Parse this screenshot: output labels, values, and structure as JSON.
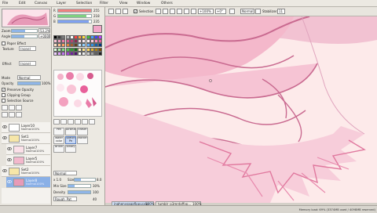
{
  "menu": {
    "file": "File",
    "edit": "Edit",
    "canvas": "Canvas",
    "layer": "Layer",
    "selection": "Selection",
    "filter": "Filter",
    "view": "View",
    "window": "Window",
    "others": "Others"
  },
  "toolbar": {
    "selection_label": "Selection",
    "zoom_value": "+100%",
    "angle_value": "+0°",
    "mode_value": "Normal",
    "stabilizer_label": "Stabilizer",
    "stabilizer_value": "11"
  },
  "navigator": {
    "zoom_label": "Zoom",
    "zoom_value": "53.2%",
    "angle_label": "Angle",
    "angle_value": "+0000"
  },
  "paper": {
    "effect_label": "Paper Effect",
    "texture_label": "Texture",
    "texture_value": "(none)",
    "effect_label_2": "Effect",
    "effect_value": "(none)"
  },
  "layer_props": {
    "mode_label": "Mode",
    "mode_value": "Normal",
    "opacity_label": "Opacity",
    "opacity_value": "100%",
    "preserve_opacity": "Preserve Opacity",
    "clipping_group": "Clipping Group",
    "selection_source": "Selection Source"
  },
  "layers": [
    {
      "name": "Layer10",
      "mode": "Normal",
      "op": "100%"
    },
    {
      "name": "Set1",
      "mode": "Normal",
      "op": "100%"
    },
    {
      "name": "Layer7",
      "mode": "Normal",
      "op": "100%"
    },
    {
      "name": "Layer5",
      "mode": "Normal",
      "op": "100%"
    },
    {
      "name": "Set2",
      "mode": "Normal",
      "op": "100%"
    },
    {
      "name": "Layer8",
      "mode": "Normal",
      "op": "100%"
    }
  ],
  "color": {
    "r_value": "255",
    "g_value": "218",
    "b_value": "235",
    "fg_color": "#f2a6c8",
    "palette": [
      "#000000",
      "#3a3a3a",
      "#7a7a7a",
      "#b8b8b8",
      "#ffffff",
      "#ff4040",
      "#ffa040",
      "#ffe040",
      "#40c040",
      "#40a0ff",
      "#4040ff",
      "#c040ff",
      "#f9c4d6",
      "#f3a1bf",
      "#e97ca8",
      "#d65b8e",
      "#b8416f",
      "#8a2a52",
      "#fbd9e5",
      "#fce8ef",
      "#fff0f5",
      "#ffd0e0",
      "#ff90b8",
      "#e8609a",
      "#ffe0c8",
      "#ffc090",
      "#ffa060",
      "#e08040",
      "#a06030",
      "#604020",
      "#c0e8ff",
      "#90d0ff",
      "#60b0ff",
      "#3090e0",
      "#1060b0",
      "#003880",
      "#e0ffe0",
      "#b0f0b0",
      "#80e080",
      "#50c050",
      "#30a030",
      "#107010",
      "#fff4c0",
      "#ffe890",
      "#ffd860",
      "#e0b030",
      "#b08010",
      "#805000",
      "#f0d0ff",
      "#e0a0ff",
      "#c070f0",
      "#a040d0",
      "#7020a0",
      "#501070",
      "#ffffff",
      "#f0f0f0",
      "#d0d0d0",
      "#a0a0a0",
      "#606060",
      "#202020"
    ]
  },
  "tools": {
    "pen": "Pen",
    "airbrush": "AirBrush",
    "eraser": "Eraser",
    "watercolor": "Water color",
    "sketch": "Sketch Pe",
    "marker": "Marker",
    "brush": "Brush",
    "binary": "Binary"
  },
  "brush": {
    "mode_value": "Normal",
    "size_label": "Size",
    "size_value": "x 1.0",
    "size_px": "8.0",
    "minsize_label": "Min Size",
    "minsize_value": "30%",
    "density_label": "Density",
    "density_value": "100",
    "texture_value": "Rough_Pat",
    "texture_amount": "40"
  },
  "file_tabs": [
    {
      "name": "inghenysagaflppy.png",
      "zoom": "100%"
    },
    {
      "name": "tumblr_p3mrdxffyp...",
      "zoom": "100%"
    }
  ],
  "status": {
    "memory": "Memory load: 69% (3374MB used / 4098MB reserved)"
  }
}
